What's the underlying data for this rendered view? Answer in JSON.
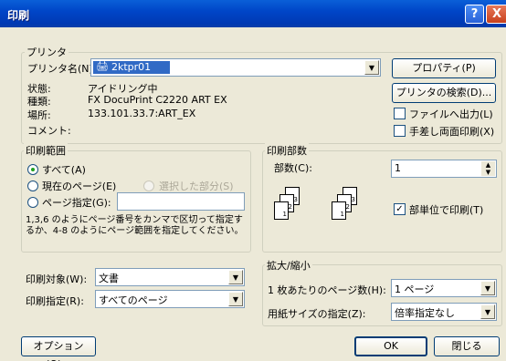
{
  "window": {
    "title": "印刷"
  },
  "printer": {
    "group_label": "プリンタ",
    "name_label": "プリンタ名(N):",
    "name_value": "2ktpr01",
    "properties_button": "プロパティ(P)",
    "find_button": "プリンタの検索(D)...",
    "status_label": "状態:",
    "status_value": "アイドリング中",
    "type_label": "種類:",
    "type_value": "FX DocuPrint C2220 ART EX",
    "where_label": "場所:",
    "where_value": "133.101.33.7:ART_EX",
    "comment_label": "コメント:",
    "print_to_file": "ファイルへ出力(L)",
    "manual_duplex": "手差し両面印刷(X)"
  },
  "range": {
    "group_label": "印刷範囲",
    "all": "すべて(A)",
    "current": "現在のページ(E)",
    "selection": "選択した部分(S)",
    "pages": "ページ指定(G):",
    "pages_value": "",
    "hint": "1,3,6 のようにページ番号をカンマで区切って指定するか、4-8 のようにページ範囲を指定してください。"
  },
  "copies": {
    "group_label": "印刷部数",
    "count_label": "部数(C):",
    "count_value": "1",
    "collate": "部単位で印刷(T)",
    "page_numbers": [
      "1",
      "2",
      "3"
    ]
  },
  "print_what": {
    "label": "印刷対象(W):",
    "value": "文書"
  },
  "print_spec": {
    "label": "印刷指定(R):",
    "value": "すべてのページ"
  },
  "zoom": {
    "group_label": "拡大/縮小",
    "pps_label": "1 枚あたりのページ数(H):",
    "pps_value": "1 ページ",
    "scale_label": "用紙サイズの指定(Z):",
    "scale_value": "倍率指定なし"
  },
  "buttons": {
    "options": "オプション(O)...",
    "ok": "OK",
    "close": "閉じる"
  },
  "titlebar_buttons": {
    "help": "?",
    "close": "X"
  },
  "colors": {
    "title_bar": "#0046c8",
    "selection": "#316ac5",
    "face": "#ece9d8"
  }
}
